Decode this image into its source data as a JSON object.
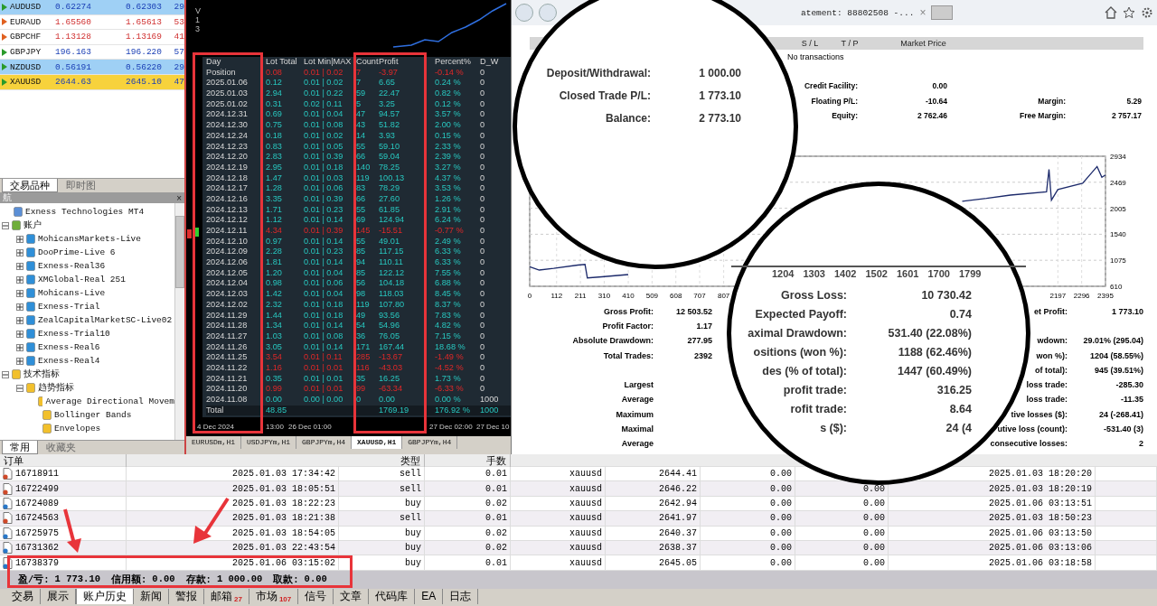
{
  "market_watch": {
    "rows": [
      {
        "symbol": "AUDUSD",
        "bid": "0.62274",
        "ask": "0.62303",
        "spread": "29",
        "falling": false,
        "color": "#9fd0f5"
      },
      {
        "symbol": "EURAUD",
        "bid": "1.65560",
        "ask": "1.65613",
        "spread": "53",
        "falling": true,
        "color": "#ffffff"
      },
      {
        "symbol": "GBPCHF",
        "bid": "1.13128",
        "ask": "1.13169",
        "spread": "41",
        "falling": true,
        "color": "#ffffff"
      },
      {
        "symbol": "GBPJPY",
        "bid": "196.163",
        "ask": "196.220",
        "spread": "57",
        "falling": false,
        "color": "#ffffff"
      },
      {
        "symbol": "NZDUSD",
        "bid": "0.56191",
        "ask": "0.56220",
        "spread": "29",
        "falling": false,
        "color": "#9fd0f5"
      },
      {
        "symbol": "XAUUSD",
        "bid": "2644.63",
        "ask": "2645.10",
        "spread": "47",
        "falling": false,
        "color": "#f7d23c"
      }
    ],
    "tabs": [
      {
        "label": "交易品种",
        "selected": true
      },
      {
        "label": "即时图",
        "selected": false
      }
    ]
  },
  "navigator": {
    "title": "航",
    "close": "×",
    "tree": [
      {
        "label": "Exness Technologies MT4",
        "kind": "terminal"
      },
      {
        "label": "账户",
        "kind": "folder",
        "expanded": true,
        "children": [
          {
            "label": "MohicansMarkets-Live",
            "kind": "account",
            "expanded": false
          },
          {
            "label": "DooPrime-Live 6",
            "kind": "account",
            "expanded": false
          },
          {
            "label": "Exness-Real36",
            "kind": "account",
            "expanded": false
          },
          {
            "label": "XMGlobal-Real 251",
            "kind": "account",
            "expanded": false
          },
          {
            "label": "Mohicans-Live",
            "kind": "account",
            "expanded": false
          },
          {
            "label": "Exness-Trial",
            "kind": "account",
            "expanded": false
          },
          {
            "label": "ZealCapitalMarketSC-Live02",
            "kind": "account",
            "expanded": false
          },
          {
            "label": "Exness-Trial10",
            "kind": "account",
            "expanded": false
          },
          {
            "label": "Exness-Real6",
            "kind": "account",
            "expanded": false
          },
          {
            "label": "Exness-Real4",
            "kind": "account",
            "expanded": false
          }
        ]
      },
      {
        "label": "技术指标",
        "kind": "indicator",
        "expanded": true,
        "children": [
          {
            "label": "趋势指标",
            "kind": "indicator",
            "expanded": true,
            "children": [
              {
                "label": "Average Directional Movem",
                "kind": "indicator"
              },
              {
                "label": "Bollinger Bands",
                "kind": "indicator"
              },
              {
                "label": "Envelopes",
                "kind": "indicator"
              }
            ]
          }
        ]
      }
    ],
    "tabs": [
      {
        "label": "常用",
        "selected": true
      },
      {
        "label": "收藏夹",
        "selected": false
      }
    ]
  },
  "chart_window": {
    "version_label": "V13",
    "stats_table": {
      "columns": [
        "Day",
        "Lot Total",
        "Lot Min|MAX",
        "Count",
        "Profit",
        "Percent%",
        "D_W"
      ],
      "rows": [
        {
          "day": "Position",
          "lot_total": "0.08",
          "lot_minmax": "0.01 | 0.02",
          "count": "7",
          "profit": "-3.97",
          "percent": "-0.14 %",
          "d_w": "0",
          "negative": true
        },
        {
          "day": "2025.01.06",
          "lot_total": "0.12",
          "lot_minmax": "0.01 | 0.02",
          "count": "7",
          "profit": "6.65",
          "percent": "0.24 %",
          "d_w": "0",
          "negative": false
        },
        {
          "day": "2025.01.03",
          "lot_total": "2.94",
          "lot_minmax": "0.01 | 0.22",
          "count": "59",
          "profit": "22.47",
          "percent": "0.82 %",
          "d_w": "0",
          "negative": false
        },
        {
          "day": "2025.01.02",
          "lot_total": "0.31",
          "lot_minmax": "0.02 | 0.11",
          "count": "5",
          "profit": "3.25",
          "percent": "0.12 %",
          "d_w": "0",
          "negative": false
        },
        {
          "day": "2024.12.31",
          "lot_total": "0.69",
          "lot_minmax": "0.01 | 0.04",
          "count": "47",
          "profit": "94.57",
          "percent": "3.57 %",
          "d_w": "0",
          "negative": false
        },
        {
          "day": "2024.12.30",
          "lot_total": "0.75",
          "lot_minmax": "0.01 | 0.08",
          "count": "43",
          "profit": "51.82",
          "percent": "2.00 %",
          "d_w": "0",
          "negative": false
        },
        {
          "day": "2024.12.24",
          "lot_total": "0.18",
          "lot_minmax": "0.01 | 0.02",
          "count": "14",
          "profit": "3.93",
          "percent": "0.15 %",
          "d_w": "0",
          "negative": false
        },
        {
          "day": "2024.12.23",
          "lot_total": "0.83",
          "lot_minmax": "0.01 | 0.05",
          "count": "55",
          "profit": "59.10",
          "percent": "2.33 %",
          "d_w": "0",
          "negative": false
        },
        {
          "day": "2024.12.20",
          "lot_total": "2.83",
          "lot_minmax": "0.01 | 0.39",
          "count": "66",
          "profit": "59.04",
          "percent": "2.39 %",
          "d_w": "0",
          "negative": false
        },
        {
          "day": "2024.12.19",
          "lot_total": "2.95",
          "lot_minmax": "0.01 | 0.18",
          "count": "140",
          "profit": "78.25",
          "percent": "3.27 %",
          "d_w": "0",
          "negative": false
        },
        {
          "day": "2024.12.18",
          "lot_total": "1.47",
          "lot_minmax": "0.01 | 0.03",
          "count": "119",
          "profit": "100.13",
          "percent": "4.37 %",
          "d_w": "0",
          "negative": false
        },
        {
          "day": "2024.12.17",
          "lot_total": "1.28",
          "lot_minmax": "0.01 | 0.06",
          "count": "83",
          "profit": "78.29",
          "percent": "3.53 %",
          "d_w": "0",
          "negative": false
        },
        {
          "day": "2024.12.16",
          "lot_total": "3.35",
          "lot_minmax": "0.01 | 0.39",
          "count": "66",
          "profit": "27.60",
          "percent": "1.26 %",
          "d_w": "0",
          "negative": false
        },
        {
          "day": "2024.12.13",
          "lot_total": "1.71",
          "lot_minmax": "0.01 | 0.23",
          "count": "55",
          "profit": "61.85",
          "percent": "2.91 %",
          "d_w": "0",
          "negative": false
        },
        {
          "day": "2024.12.12",
          "lot_total": "1.12",
          "lot_minmax": "0.01 | 0.14",
          "count": "69",
          "profit": "124.94",
          "percent": "6.24 %",
          "d_w": "0",
          "negative": false
        },
        {
          "day": "2024.12.11",
          "lot_total": "4.34",
          "lot_minmax": "0.01 | 0.39",
          "count": "145",
          "profit": "-15.51",
          "percent": "-0.77 %",
          "d_w": "0",
          "negative": true
        },
        {
          "day": "2024.12.10",
          "lot_total": "0.97",
          "lot_minmax": "0.01 | 0.14",
          "count": "55",
          "profit": "49.01",
          "percent": "2.49 %",
          "d_w": "0",
          "negative": false
        },
        {
          "day": "2024.12.09",
          "lot_total": "2.28",
          "lot_minmax": "0.01 | 0.23",
          "count": "85",
          "profit": "117.15",
          "percent": "6.33 %",
          "d_w": "0",
          "negative": false
        },
        {
          "day": "2024.12.06",
          "lot_total": "1.81",
          "lot_minmax": "0.01 | 0.14",
          "count": "94",
          "profit": "110.11",
          "percent": "6.33 %",
          "d_w": "0",
          "negative": false
        },
        {
          "day": "2024.12.05",
          "lot_total": "1.20",
          "lot_minmax": "0.01 | 0.04",
          "count": "85",
          "profit": "122.12",
          "percent": "7.55 %",
          "d_w": "0",
          "negative": false
        },
        {
          "day": "2024.12.04",
          "lot_total": "0.98",
          "lot_minmax": "0.01 | 0.06",
          "count": "56",
          "profit": "104.18",
          "percent": "6.88 %",
          "d_w": "0",
          "negative": false
        },
        {
          "day": "2024.12.03",
          "lot_total": "1.42",
          "lot_minmax": "0.01 | 0.04",
          "count": "98",
          "profit": "118.03",
          "percent": "8.45 %",
          "d_w": "0",
          "negative": false
        },
        {
          "day": "2024.12.02",
          "lot_total": "2.32",
          "lot_minmax": "0.01 | 0.18",
          "count": "119",
          "profit": "107.80",
          "percent": "8.37 %",
          "d_w": "0",
          "negative": false
        },
        {
          "day": "2024.11.29",
          "lot_total": "1.44",
          "lot_minmax": "0.01 | 0.18",
          "count": "49",
          "profit": "93.56",
          "percent": "7.83 %",
          "d_w": "0",
          "negative": false
        },
        {
          "day": "2024.11.28",
          "lot_total": "1.34",
          "lot_minmax": "0.01 | 0.14",
          "count": "54",
          "profit": "54.96",
          "percent": "4.82 %",
          "d_w": "0",
          "negative": false
        },
        {
          "day": "2024.11.27",
          "lot_total": "1.03",
          "lot_minmax": "0.01 | 0.08",
          "count": "36",
          "profit": "76.05",
          "percent": "7.15 %",
          "d_w": "0",
          "negative": false
        },
        {
          "day": "2024.11.26",
          "lot_total": "3.05",
          "lot_minmax": "0.01 | 0.14",
          "count": "171",
          "profit": "167.44",
          "percent": "18.68 %",
          "d_w": "0",
          "negative": false
        },
        {
          "day": "2024.11.25",
          "lot_total": "3.54",
          "lot_minmax": "0.01 | 0.11",
          "count": "285",
          "profit": "-13.67",
          "percent": "-1.49 %",
          "d_w": "0",
          "negative": true
        },
        {
          "day": "2024.11.22",
          "lot_total": "1.16",
          "lot_minmax": "0.01 | 0.01",
          "count": "116",
          "profit": "-43.03",
          "percent": "-4.52 %",
          "d_w": "0",
          "negative": true
        },
        {
          "day": "2024.11.21",
          "lot_total": "0.35",
          "lot_minmax": "0.01 | 0.01",
          "count": "35",
          "profit": "16.25",
          "percent": "1.73 %",
          "d_w": "0",
          "negative": false
        },
        {
          "day": "2024.11.20",
          "lot_total": "0.99",
          "lot_minmax": "0.01 | 0.01",
          "count": "99",
          "profit": "-63.34",
          "percent": "-6.33 %",
          "d_w": "0",
          "negative": true
        },
        {
          "day": "2024.11.08",
          "lot_total": "0.00",
          "lot_minmax": "0.00 | 0.00",
          "count": "0",
          "profit": "0.00",
          "percent": "0.00 %",
          "d_w": "1000",
          "negative": false
        }
      ],
      "total": {
        "label": "Total",
        "lot_total": "48.85",
        "profit": "1769.19",
        "percent": "176.92 %",
        "d_w": "1000"
      }
    },
    "time_axis": [
      "4 Dec 2024",
      "13:00",
      "26 Dec 01:00",
      "27 Dec 02:00",
      "27 Dec 10"
    ],
    "tabs": [
      {
        "label": "EURUSDm,H1",
        "selected": false
      },
      {
        "label": "USDJPYm,H1",
        "selected": false
      },
      {
        "label": "GBPJPYm,H4",
        "selected": false
      },
      {
        "label": "XAUUSD,H1",
        "selected": true
      },
      {
        "label": "GBPJPYm,H4",
        "selected": false
      }
    ]
  },
  "report": {
    "browser_tab": {
      "title": "atement: 88802508 -...",
      "close": "×"
    },
    "positions_header": [
      "S / L",
      "T / P",
      "Market Price"
    ],
    "no_transactions": "No transactions",
    "account_left": [
      {
        "label": "Credit Facility:",
        "value": "0.00"
      },
      {
        "label": "Floating P/L:",
        "value": "-10.64"
      },
      {
        "label": "Equity:",
        "value": "2 762.46"
      }
    ],
    "account_right": [
      {
        "label": "Margin:",
        "value": "5.29"
      },
      {
        "label": "Free Margin:",
        "value": "2 757.17"
      }
    ],
    "equity_chart": {
      "chart_data": {
        "type": "line",
        "grid": true,
        "xlim": [
          0,
          2395
        ],
        "ylim": [
          610,
          2934
        ],
        "xticks": [
          0,
          112,
          211,
          310,
          410,
          509,
          608,
          707,
          807,
          2197,
          2296,
          2395
        ],
        "yticks": [
          610,
          1075,
          1540,
          2005,
          2469,
          2934
        ],
        "x": [
          0,
          40,
          100,
          200,
          230,
          240,
          300,
          410,
          1799,
          1900,
          2000,
          2150,
          2160,
          2170,
          2197,
          2300,
          2360,
          2380,
          2395
        ],
        "series": [
          {
            "color": "#1c2a6b",
            "values": [
              960,
              900,
              930,
              990,
              1000,
              760,
              780,
              820,
              null,
              null,
              null,
              null,
              null,
              null,
              null,
              null,
              null,
              null,
              null
            ]
          },
          {
            "color": "#1c2a6b",
            "values": [
              null,
              null,
              null,
              null,
              null,
              null,
              null,
              null,
              2130,
              2180,
              2240,
              2300,
              2700,
              2150,
              2340,
              2450,
              2750,
              2560,
              2600
            ]
          }
        ]
      }
    },
    "stats": [
      {
        "label": "Gross Profit:",
        "value": "12 503.52",
        "right_label": "et Profit:",
        "right_value": "1 773.10"
      },
      {
        "label": "Profit Factor:",
        "value": "1.17"
      },
      {
        "label": "Absolute Drawdown:",
        "value": "277.95",
        "right_label": "wdown:",
        "right_value": "29.01% (295.04)"
      },
      {
        "label": "Total Trades:",
        "value": "2392",
        "right_label": "won %):",
        "right_value": "1204 (58.55%)"
      },
      {
        "right_label": "of total):",
        "right_value": "945 (39.51%)"
      },
      {
        "label": "Largest",
        "right_label": "loss trade:",
        "right_value": "-285.30"
      },
      {
        "label": "Average",
        "right_label": "loss trade:",
        "right_value": "-11.35"
      },
      {
        "label": "Maximum",
        "right_label": "tive losses ($):",
        "right_value": "24 (-268.41)"
      },
      {
        "label": "Maximal",
        "right_label": "utive loss (count):",
        "right_value": "-531.40 (3)"
      },
      {
        "label": "Average",
        "right_label": "consecutive losses:",
        "right_value": "2"
      }
    ]
  },
  "magnifiers": [
    {
      "kind": "summary",
      "rows": [
        {
          "label": "Deposit/Withdrawal:",
          "value": "1 000.00"
        },
        {
          "label": "Closed Trade P/L:",
          "value": "1 773.10"
        },
        {
          "label": "Balance:",
          "value": "2 773.10"
        }
      ]
    },
    {
      "kind": "stats",
      "axis_labels": [
        "1204",
        "1303",
        "1402",
        "1502",
        "1601",
        "1700",
        "1799"
      ],
      "rows": [
        {
          "label": "Gross Loss:",
          "value": "10 730.42"
        },
        {
          "label": "Expected Payoff:",
          "value": "0.74"
        },
        {
          "label": "aximal Drawdown:",
          "value": "531.40 (22.08%)"
        },
        {
          "label": "ositions (won %):",
          "value": "1188 (62.46%)"
        },
        {
          "label": "des (% of total):",
          "value": "1447 (60.49%)"
        },
        {
          "label": "profit trade:",
          "value": "316.25"
        },
        {
          "label": "rofit trade:",
          "value": "8.64"
        },
        {
          "label": "s ($):",
          "value": "24 (4"
        }
      ]
    }
  ],
  "orders": {
    "header": {
      "order": "订单",
      "type": "类型",
      "lots": "手数"
    },
    "rows": [
      {
        "id": "16718911",
        "time": "2025.01.03 17:34:42",
        "type": "sell",
        "kind": "sell",
        "lots": "0.01",
        "symbol": "xauusd",
        "price": "2644.41",
        "sl": "0.00",
        "close_time": "2025.01.03 18:20:20"
      },
      {
        "id": "16722499",
        "time": "2025.01.03 18:05:51",
        "type": "sell",
        "kind": "sell",
        "lots": "0.01",
        "symbol": "xauusd",
        "price": "2646.22",
        "sl": "0.00",
        "tp": "0.00",
        "close_time": "2025.01.03 18:20:19"
      },
      {
        "id": "16724089",
        "time": "2025.01.03 18:22:23",
        "type": "buy",
        "kind": "buy",
        "lots": "0.02",
        "symbol": "xauusd",
        "price": "2642.94",
        "sl": "0.00",
        "tp": "0.00",
        "close_time": "2025.01.06 03:13:51"
      },
      {
        "id": "16724563",
        "time": "2025.01.03 18:21:38",
        "type": "sell",
        "kind": "sell",
        "lots": "0.01",
        "symbol": "xauusd",
        "price": "2641.97",
        "sl": "0.00",
        "tp": "0.00",
        "close_time": "2025.01.03 18:50:23"
      },
      {
        "id": "16725975",
        "time": "2025.01.03 18:54:05",
        "type": "buy",
        "kind": "buy",
        "lots": "0.02",
        "symbol": "xauusd",
        "price": "2640.37",
        "sl": "0.00",
        "tp": "0.00",
        "close_time": "2025.01.06 03:13:50"
      },
      {
        "id": "16731362",
        "time": "2025.01.03 22:43:54",
        "type": "buy",
        "kind": "buy",
        "lots": "0.02",
        "symbol": "xauusd",
        "price": "2638.37",
        "sl": "0.00",
        "tp": "0.00",
        "close_time": "2025.01.06 03:13:06"
      },
      {
        "id": "16738379",
        "time": "2025.01.06 03:15:02",
        "type": "buy",
        "kind": "buy",
        "lots": "0.01",
        "symbol": "xauusd",
        "price": "2645.05",
        "sl": "0.00",
        "tp": "0.00",
        "close_time": "2025.01.06 03:18:58"
      }
    ]
  },
  "status": [
    {
      "label": "盈/亏:",
      "value": "1 773.10"
    },
    {
      "label": "信用额:",
      "value": "0.00"
    },
    {
      "label": "存款:",
      "value": "1 000.00"
    },
    {
      "label": "取款:",
      "value": "0.00"
    }
  ],
  "bottom_tabs": [
    {
      "label": "交易",
      "selected": false
    },
    {
      "label": "展示",
      "selected": false
    },
    {
      "label": "账户历史",
      "selected": true
    },
    {
      "label": "新闻",
      "selected": false
    },
    {
      "label": "警报",
      "selected": false
    },
    {
      "label": "邮箱",
      "badge": "27",
      "selected": false
    },
    {
      "label": "市场",
      "badge": "107",
      "selected": false
    },
    {
      "label": "信号",
      "selected": false
    },
    {
      "label": "文章",
      "selected": false
    },
    {
      "label": "代码库",
      "selected": false
    },
    {
      "label": "EA",
      "selected": false
    },
    {
      "label": "日志",
      "selected": false
    }
  ]
}
